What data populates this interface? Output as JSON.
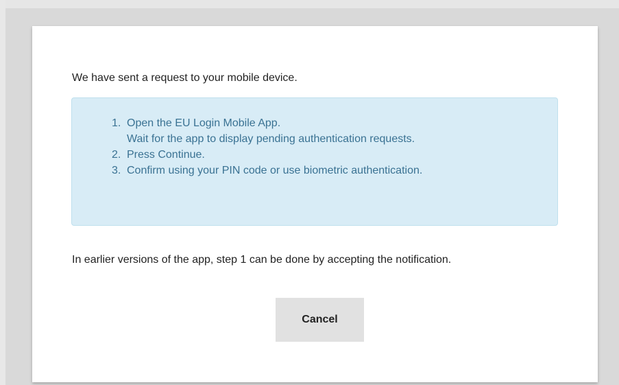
{
  "dialog": {
    "intro_text": "We have sent a request to your mobile device.",
    "steps": [
      {
        "number": "1.",
        "lines": [
          "Open the EU Login Mobile App.",
          "Wait for the app to display pending authentication requests."
        ]
      },
      {
        "number": "2.",
        "lines": [
          "Press Continue."
        ]
      },
      {
        "number": "3.",
        "lines": [
          "Confirm using your PIN code or use biometric authentication."
        ]
      }
    ],
    "note_text": "In earlier versions of the app, step 1 can be done by accepting the notification.",
    "cancel_label": "Cancel"
  },
  "colors": {
    "page_background": "#d9d9d9",
    "dialog_background": "#ffffff",
    "info_box_background": "#d8ecf6",
    "info_box_border": "#bfe0ee",
    "info_text": "#3a7293",
    "body_text": "#222222",
    "button_background": "#e1e1e1"
  }
}
